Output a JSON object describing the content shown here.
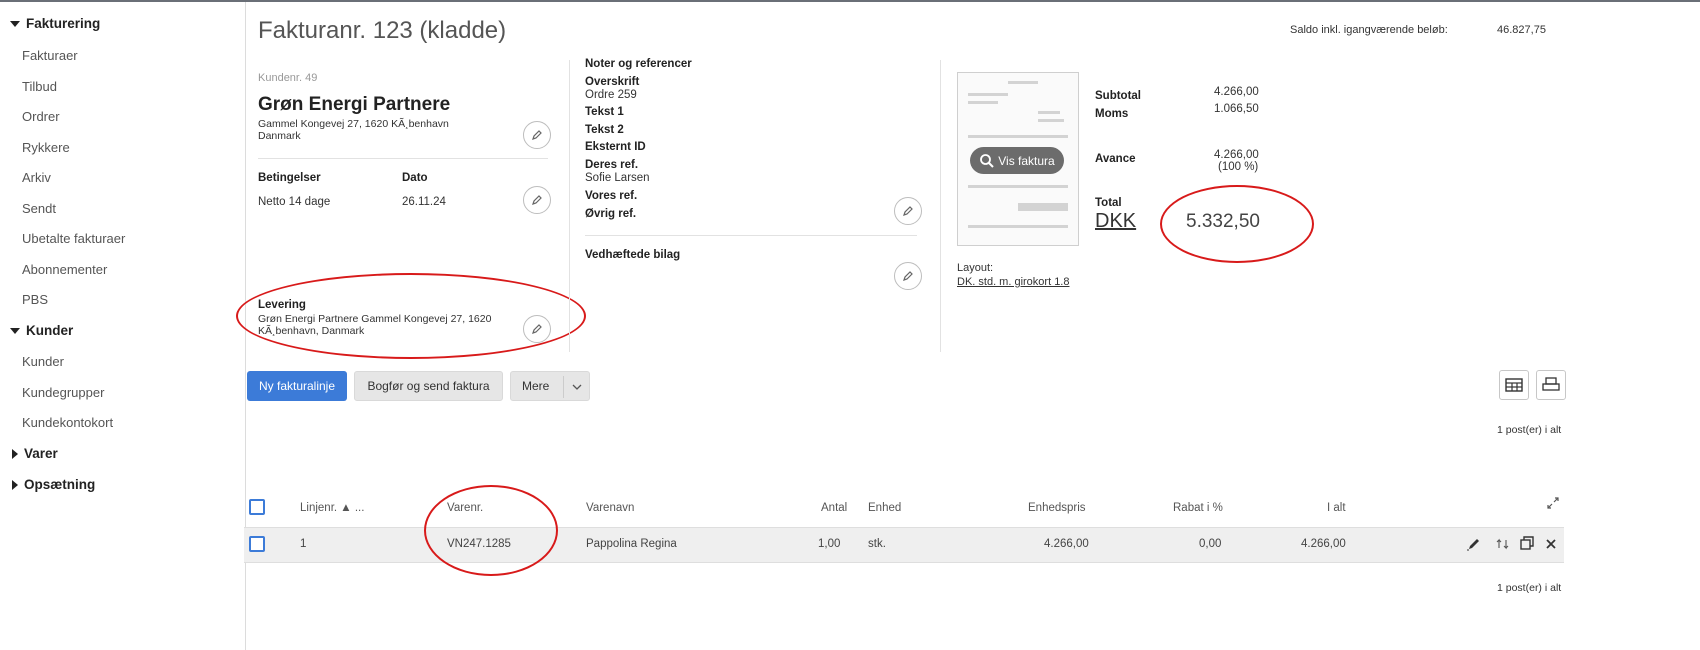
{
  "sidebar": {
    "groups": {
      "fakturering": "Fakturering",
      "kunder": "Kunder",
      "varer": "Varer",
      "opsaetning": "Opsætning"
    },
    "fakturering_items": [
      "Fakturaer",
      "Tilbud",
      "Ordrer",
      "Rykkere",
      "Arkiv",
      "Sendt",
      "Ubetalte fakturaer",
      "Abonnementer",
      "PBS"
    ],
    "kunder_items": [
      "Kunder",
      "Kundegrupper",
      "Kundekontokort"
    ]
  },
  "header": {
    "title": "Fakturanr. 123 (kladde)",
    "saldo_label": "Saldo inkl. igangværende beløb:",
    "saldo_value": "46.827,75"
  },
  "customer": {
    "number": "Kundenr. 49",
    "name": "Grøn Energi Partnere",
    "address_line1": "Gammel Kongevej 27, 1620 KÃ¸benhavn",
    "address_line2": "Danmark",
    "terms_label": "Betingelser",
    "terms_value": "Netto 14 dage",
    "date_label": "Dato",
    "date_value": "26.11.24",
    "delivery_label": "Levering",
    "delivery_line1": "Grøn Energi Partnere Gammel Kongevej 27, 1620",
    "delivery_line2": "KÃ¸benhavn, Danmark"
  },
  "notes": {
    "heading": "Noter og referencer",
    "overskrift_label": "Overskrift",
    "overskrift_value": "Ordre 259",
    "tekst1_label": "Tekst 1",
    "tekst2_label": "Tekst 2",
    "ekstern_label": "Eksternt ID",
    "deres_label": "Deres ref.",
    "deres_value": "Sofie Larsen",
    "vores_label": "Vores ref.",
    "oevrig_label": "Øvrig ref.",
    "attachments_label": "Vedhæftede bilag"
  },
  "preview": {
    "view_button": "Vis faktura",
    "layout_label": "Layout:",
    "layout_value": "DK. std. m. girokort 1.8"
  },
  "totals": {
    "subtotal_label": "Subtotal",
    "subtotal_value": "4.266,00",
    "moms_label": "Moms",
    "moms_value": "1.066,50",
    "avance_label": "Avance",
    "avance_value": "4.266,00",
    "avance_pct": "(100 %)",
    "total_label": "Total",
    "currency": "DKK",
    "total_value": "5.332,50"
  },
  "actions": {
    "new_line": "Ny fakturalinje",
    "post_send": "Bogfør og send faktura",
    "more": "Mere"
  },
  "table": {
    "count_top": "1 post(er) i alt",
    "count_bottom": "1 post(er) i alt",
    "headers": {
      "line_no": "Linjenr. ▲ ...",
      "item_no": "Varenr.",
      "item_name": "Varenavn",
      "qty": "Antal",
      "unit": "Enhed",
      "unit_price": "Enhedspris",
      "discount": "Rabat i %",
      "total": "I alt"
    },
    "rows": [
      {
        "line_no": "1",
        "item_no": "VN247.1285",
        "item_name": "Pappolina Regina",
        "qty": "1,00",
        "unit": "stk.",
        "unit_price": "4.266,00",
        "discount": "0,00",
        "total": "4.266,00"
      }
    ]
  },
  "colors": {
    "primary": "#3c7bd8",
    "annotation": "#d81a1a"
  }
}
